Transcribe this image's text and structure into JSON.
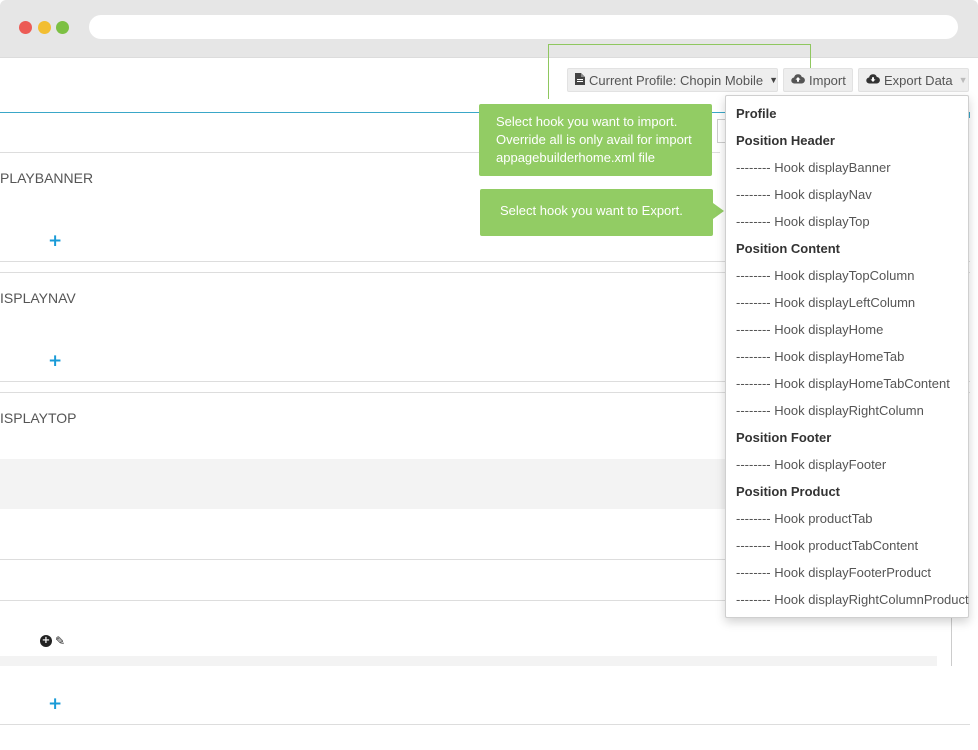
{
  "toolbar": {
    "profile_label": "Current Profile: Chopin Mobile",
    "import_label": "Import",
    "export_label": "Export Data"
  },
  "rows": [
    {
      "label": "PLAYBANNER"
    },
    {
      "label": "ISPLAYNAV"
    },
    {
      "label": "ISPLAYTOP"
    }
  ],
  "tooltips": {
    "import_lines": [
      "Select hook you want to import.",
      "Override all is only avail for import",
      "appagebuilderhome.xml file"
    ],
    "export": "Select hook you want to Export."
  },
  "dropdown": {
    "items": [
      {
        "label": "Profile",
        "type": "header"
      },
      {
        "label": "Position Header",
        "type": "header"
      },
      {
        "label": "-------- Hook displayBanner",
        "type": "item"
      },
      {
        "label": "-------- Hook displayNav",
        "type": "item"
      },
      {
        "label": "-------- Hook displayTop",
        "type": "item"
      },
      {
        "label": "Position Content",
        "type": "header"
      },
      {
        "label": "-------- Hook displayTopColumn",
        "type": "item"
      },
      {
        "label": "-------- Hook displayLeftColumn",
        "type": "item"
      },
      {
        "label": "-------- Hook displayHome",
        "type": "item"
      },
      {
        "label": "-------- Hook displayHomeTab",
        "type": "item"
      },
      {
        "label": "-------- Hook displayHomeTabContent",
        "type": "item"
      },
      {
        "label": "-------- Hook displayRightColumn",
        "type": "item"
      },
      {
        "label": "Position Footer",
        "type": "header"
      },
      {
        "label": "-------- Hook displayFooter",
        "type": "item"
      },
      {
        "label": "Position Product",
        "type": "header"
      },
      {
        "label": "-------- Hook productTab",
        "type": "item"
      },
      {
        "label": "-------- Hook productTabContent",
        "type": "item"
      },
      {
        "label": "-------- Hook displayFooterProduct",
        "type": "item"
      },
      {
        "label": "-------- Hook displayRightColumnProduct",
        "type": "item"
      }
    ]
  },
  "icons": {
    "add": "plus-icon",
    "file": "file-icon",
    "cloud_upload": "cloud-upload-icon",
    "cloud_download": "cloud-download-icon"
  },
  "colors": {
    "accent_blue": "#1a9bd7",
    "tooltip_green": "#92cc64",
    "panel_border": "#3aa7c8"
  }
}
